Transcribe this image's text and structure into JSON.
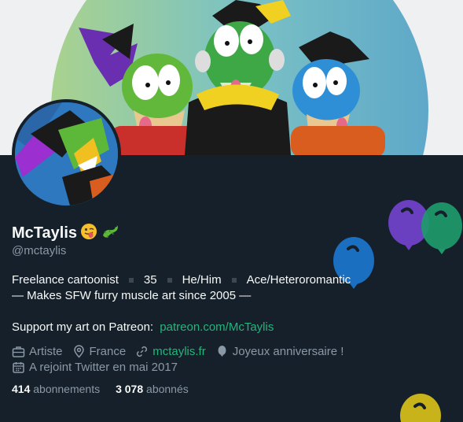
{
  "profile": {
    "display_name": "McTaylis",
    "handle": "@mctaylis",
    "name_emojis": [
      "winking-tongue-emoji",
      "lizard-emoji"
    ]
  },
  "bio": {
    "tags": [
      "Freelance cartoonist",
      "35",
      "He/Him",
      "Ace/Heteroromantic"
    ],
    "line2": "— Makes SFW furry muscle art since 2005 —",
    "patreon_prefix": "Support my art on Patreon:",
    "patreon_link": "patreon.com/McTaylis"
  },
  "meta": {
    "category": "Artiste",
    "location": "France",
    "website": "mctaylis.fr",
    "birthday": "Joyeux anniversaire !",
    "joined": "A rejoint Twitter en mai 2017"
  },
  "stats": {
    "following_count": "414",
    "following_label": "abonnements",
    "followers_count": "3 078",
    "followers_label": "abonnés"
  },
  "colors": {
    "background": "#15202b",
    "text": "#f7f9f9",
    "secondary_text": "#8b98a5",
    "link": "#22b67a"
  }
}
